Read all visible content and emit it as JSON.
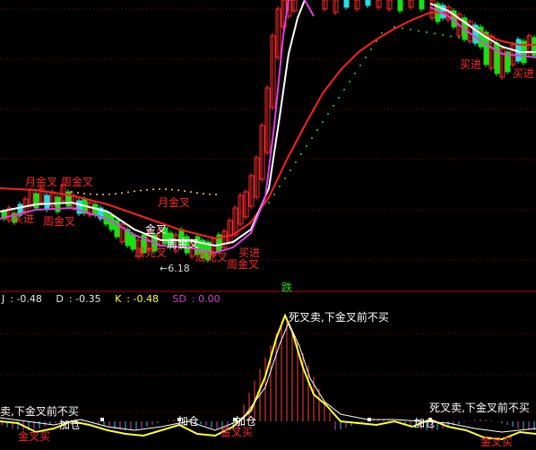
{
  "colors": {
    "background": "#000000",
    "grid": "#8b0000",
    "up_candle": "#ff2a2a",
    "down_candle": "#16e016",
    "cyan_candle": "#22e0e0",
    "white_line": "#ffffff",
    "magenta_line": "#e040e0",
    "red_line": "#ff2020",
    "yellow_line": "#ffff33",
    "green_dots": "#22dd22",
    "hist_red": "#ff4040",
    "hist_magenta": "#d040d0",
    "hist_cyan": "#40c0e0"
  },
  "main_panel": {
    "annotations": [
      {
        "text": "月金叉",
        "color": "red"
      },
      {
        "text": "周金叉",
        "color": "red"
      },
      {
        "text": "周金叉",
        "color": "red"
      },
      {
        "text": "买进",
        "color": "red"
      },
      {
        "text": "月金叉",
        "color": "red"
      },
      {
        "text": "金叉",
        "color": "white"
      },
      {
        "text": "周金叉",
        "color": "white"
      },
      {
        "text": "周死叉",
        "color": "red"
      },
      {
        "text": "周死叉",
        "color": "red"
      },
      {
        "text": "买进",
        "color": "red"
      },
      {
        "text": "周金叉",
        "color": "red"
      },
      {
        "text": "买进",
        "color": "red"
      },
      {
        "text": "买进",
        "color": "red"
      }
    ],
    "price_marker": "←6.18",
    "down_label": "跌"
  },
  "indicator_panel": {
    "readout": [
      {
        "name": "J",
        "value": "-0.48",
        "color": "#e8e8e8"
      },
      {
        "name": "D",
        "value": "-0.35",
        "color": "#e8e8e8"
      },
      {
        "name": "K",
        "value": "-0.48",
        "color": "#ffff33"
      },
      {
        "name": "SD",
        "value": "0.00",
        "color": "#d040d0"
      }
    ],
    "annotations": [
      {
        "text": "死叉卖,下金叉前不买",
        "color": "white"
      },
      {
        "text": "卖,下金叉前不买",
        "color": "white"
      },
      {
        "text": "死叉卖,下金叉前不买",
        "color": "white"
      },
      {
        "text": "金叉买",
        "color": "red"
      },
      {
        "text": "加仓",
        "color": "white"
      },
      {
        "text": "加仓",
        "color": "white"
      },
      {
        "text": "加仓",
        "color": "white"
      },
      {
        "text": "金叉买",
        "color": "red"
      },
      {
        "text": "加仓",
        "color": "white"
      },
      {
        "text": "金叉买",
        "color": "red"
      }
    ]
  }
}
